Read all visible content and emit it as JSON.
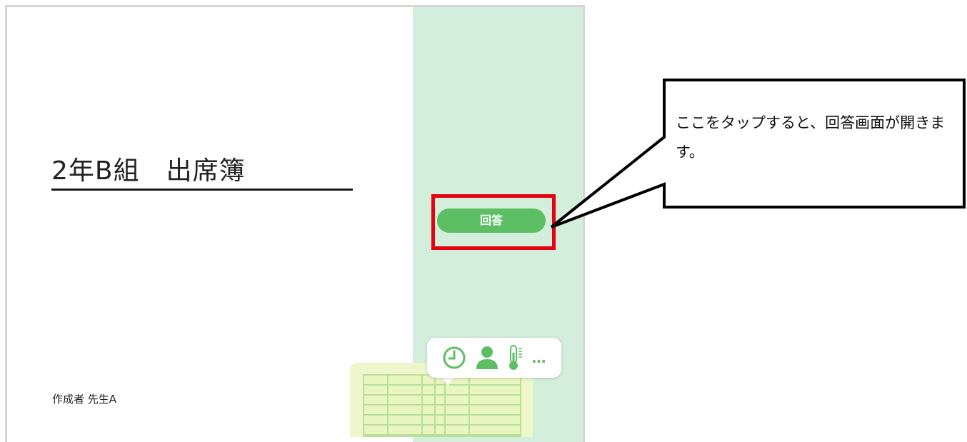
{
  "form": {
    "title": "2年B組　出席簿",
    "author": "作成者 先生A",
    "answer_button_label": "回答"
  },
  "callout": {
    "text": "ここをタップすると、回答画面が開きます。"
  },
  "illustration": {
    "icons": [
      "clock-icon",
      "person-icon",
      "thermometer-icon",
      "more-icon"
    ],
    "more_label": "…"
  },
  "colors": {
    "accent_green": "#5cbf63",
    "panel_green": "#d3eedb",
    "highlight_red": "#e60012"
  }
}
